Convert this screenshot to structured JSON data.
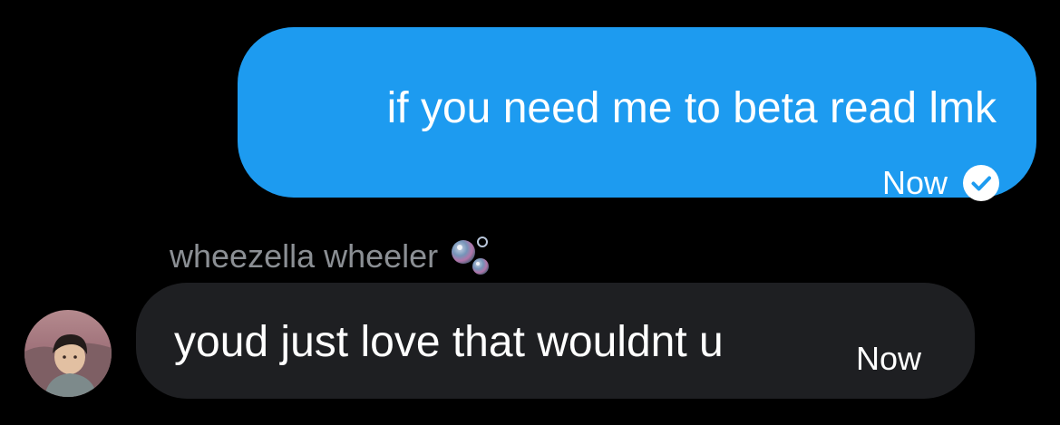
{
  "outgoing_message": {
    "text": "if you need me to beta read lmk",
    "time": "Now",
    "status_icon": "check-circle-icon",
    "bubble_color": "#1d9bf0"
  },
  "incoming_message": {
    "sender_name": "wheezella wheeler",
    "sender_badge_icon": "bubbles-icon",
    "avatar": "avatar",
    "text": "youd just love that wouldnt u",
    "time": "Now",
    "bubble_color": "#1e1f22"
  }
}
